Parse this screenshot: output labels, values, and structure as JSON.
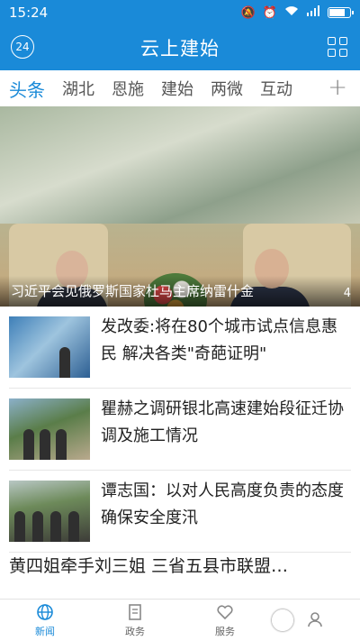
{
  "status": {
    "time": "15:24",
    "battery_level": 0.8
  },
  "header": {
    "title": "云上建始",
    "weather_badge": "24"
  },
  "tabs": [
    {
      "label": "头条",
      "active": true
    },
    {
      "label": "湖北"
    },
    {
      "label": "恩施"
    },
    {
      "label": "建始"
    },
    {
      "label": "两微"
    },
    {
      "label": "互动"
    }
  ],
  "tab_add": "+",
  "hero": {
    "caption": "习近平会见俄罗斯国家杜马主席纳雷什金",
    "pager": "4"
  },
  "news": [
    {
      "headline": "发改委:将在80个城市试点信息惠民 解决各类\"奇葩证明\""
    },
    {
      "headline": "瞿赫之调研银北高速建始段征迁协调及施工情况"
    },
    {
      "headline": "谭志国：以对人民高度负责的态度确保安全度汛"
    },
    {
      "headline": "黄四姐牵手刘三姐 三省五县市联盟…"
    }
  ],
  "bottom_nav": [
    {
      "label": "新闻",
      "active": true,
      "icon": "globe-icon"
    },
    {
      "label": "政务",
      "icon": "document-icon"
    },
    {
      "label": "服务",
      "icon": "heart-icon"
    },
    {
      "label": "",
      "icon": "person-icon"
    }
  ],
  "colors": {
    "accent": "#1a8ad8"
  }
}
